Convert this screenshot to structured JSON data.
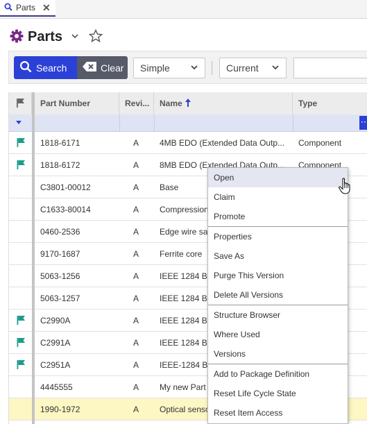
{
  "tab": {
    "label": "Parts"
  },
  "header": {
    "title": "Parts"
  },
  "toolbar": {
    "search_label": "Search",
    "clear_label": "Clear",
    "mode_value": "Simple",
    "version_value": "Current",
    "search_input_value": ""
  },
  "grid": {
    "columns": [
      "Part Number",
      "Revi...",
      "Name",
      "Type"
    ],
    "rows": [
      {
        "flag": true,
        "number": "1818-6171",
        "rev": "A",
        "name": "4MB EDO (Extended Data Outp...",
        "type": "Component"
      },
      {
        "flag": true,
        "number": "1818-6172",
        "rev": "A",
        "name": "8MB EDO (Extended Data Outp...",
        "type": "Component"
      },
      {
        "flag": false,
        "number": "C3801-00012",
        "rev": "A",
        "name": "Base",
        "type": ""
      },
      {
        "flag": false,
        "number": "C1633-80014",
        "rev": "A",
        "name": "Compression",
        "type": ""
      },
      {
        "flag": false,
        "number": "0460-2536",
        "rev": "A",
        "name": "Edge wire sa",
        "type": ""
      },
      {
        "flag": false,
        "number": "9170-1687",
        "rev": "A",
        "name": "Ferrite core",
        "type": ""
      },
      {
        "flag": false,
        "number": "5063-1256",
        "rev": "A",
        "name": "IEEE 1284 Bi",
        "type": ""
      },
      {
        "flag": false,
        "number": "5063-1257",
        "rev": "A",
        "name": "IEEE 1284 Bi",
        "type": ""
      },
      {
        "flag": true,
        "number": "C2990A",
        "rev": "A",
        "name": "IEEE 1284 Bi",
        "type": ""
      },
      {
        "flag": true,
        "number": "C2991A",
        "rev": "A",
        "name": "IEEE 1284 Bi",
        "type": ""
      },
      {
        "flag": true,
        "number": "C2951A",
        "rev": "A",
        "name": "IEEE-1284 Bi",
        "type": ""
      },
      {
        "flag": false,
        "number": "4445555",
        "rev": "A",
        "name": "My new Part",
        "type": ""
      },
      {
        "flag": false,
        "number": "1990-1972",
        "rev": "A",
        "name": "Optical sensc",
        "type": "",
        "highlight": true
      }
    ]
  },
  "context_menu": {
    "groups": [
      [
        "Open",
        "Claim",
        "Promote"
      ],
      [
        "Properties",
        "Save As",
        "Purge This Version",
        "Delete All Versions"
      ],
      [
        "Structure Browser",
        "Where Used",
        "Versions"
      ],
      [
        "Add to Package Definition",
        "Reset Life Cycle State",
        "Reset Item Access"
      ]
    ],
    "active_item": "Open"
  },
  "colors": {
    "accent": "#2b40d6",
    "flag": "#1c9c8c",
    "gear": "#7a2a8a",
    "row_highlight": "#fcf7c3",
    "clear_button": "#565a69"
  }
}
